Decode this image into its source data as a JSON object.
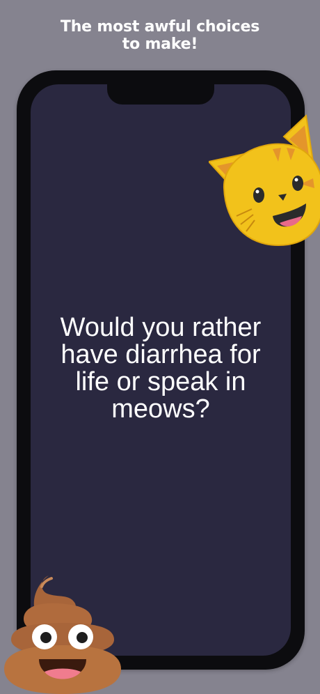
{
  "header": {
    "line1": "The most awful choices",
    "line2": "to make!"
  },
  "question": {
    "text": "Would you rather have diarrhea for life or speak in meows?"
  },
  "stickers": {
    "top": "cat-face-emoji",
    "bottom": "pile-of-poo-emoji"
  },
  "colors": {
    "background": "#85838f",
    "screen": "#2a2840",
    "frame": "#0c0c0f",
    "text": "#ffffff"
  }
}
